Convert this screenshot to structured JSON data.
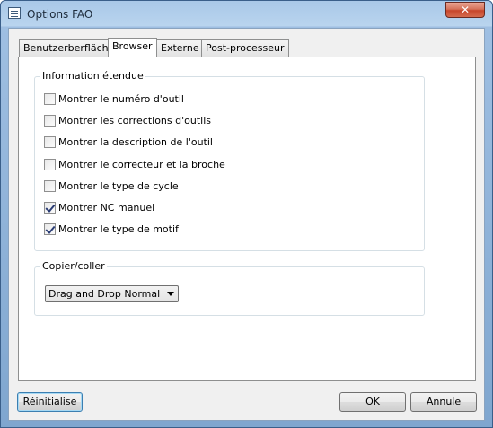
{
  "window": {
    "title": "Options FAO",
    "close_symbol": "✕",
    "icon": "window-list-icon"
  },
  "tabs": [
    {
      "label": "Benutzerberfläche",
      "selected": false
    },
    {
      "label": "Browser",
      "selected": true
    },
    {
      "label": "Externe",
      "selected": false
    },
    {
      "label": "Post-processeur",
      "selected": false
    }
  ],
  "info_group": {
    "title": "Information étendue",
    "options": [
      {
        "label": "Montrer le numéro d'outil",
        "checked": false
      },
      {
        "label": "Montrer les corrections d'outils",
        "checked": false
      },
      {
        "label": "Montrer la description de l'outil",
        "checked": false
      },
      {
        "label": "Montrer le correcteur et la broche",
        "checked": false
      },
      {
        "label": "Montrer le type de cycle",
        "checked": false
      },
      {
        "label": "Montrer NC manuel",
        "checked": true
      },
      {
        "label": "Montrer le type de motif",
        "checked": true
      }
    ]
  },
  "copy_group": {
    "title": "Copier/coller",
    "selected_value": "Drag and Drop Normal"
  },
  "buttons": {
    "reset": "Réinitialise",
    "ok": "OK",
    "cancel": "Annule"
  }
}
